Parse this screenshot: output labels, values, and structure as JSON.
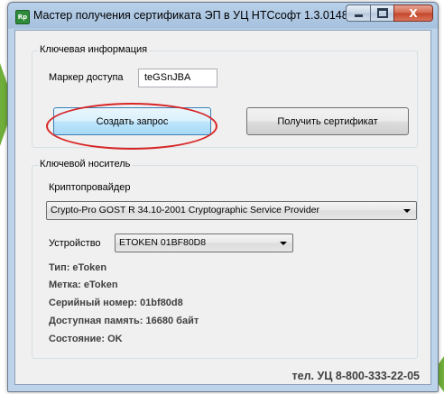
{
  "window": {
    "title": "Мастер получения сертификата ЭП в УЦ НТСсофт 1.3.0148",
    "icon_text": "Rp",
    "close_label": "X"
  },
  "key_info": {
    "group_label": "Ключевая информация",
    "token_label": "Маркер доступа",
    "token_value": "teGSnJBA",
    "create_request": "Создать запрос",
    "get_certificate": "Получить сертификат"
  },
  "key_media": {
    "group_label": "Ключевой носитель",
    "provider_label": "Криптопровайдер",
    "provider_value": "Crypto-Pro GOST R 34.10-2001 Cryptographic Service Provider",
    "device_label": "Устройство",
    "device_value": "ETOKEN 01BF80D8",
    "details": [
      "Тип: eToken",
      "Метка: eToken",
      "Серийный номер: 01bf80d8",
      "Доступная память: 16680 байт",
      "Состояние: OK"
    ]
  },
  "footer": {
    "phone": "тел. УЦ 8-800-333-22-05"
  },
  "colors": {
    "annotation_ellipse": "#d82525",
    "arrow": "#6fae3a",
    "hot_button": "#bee6fd"
  }
}
